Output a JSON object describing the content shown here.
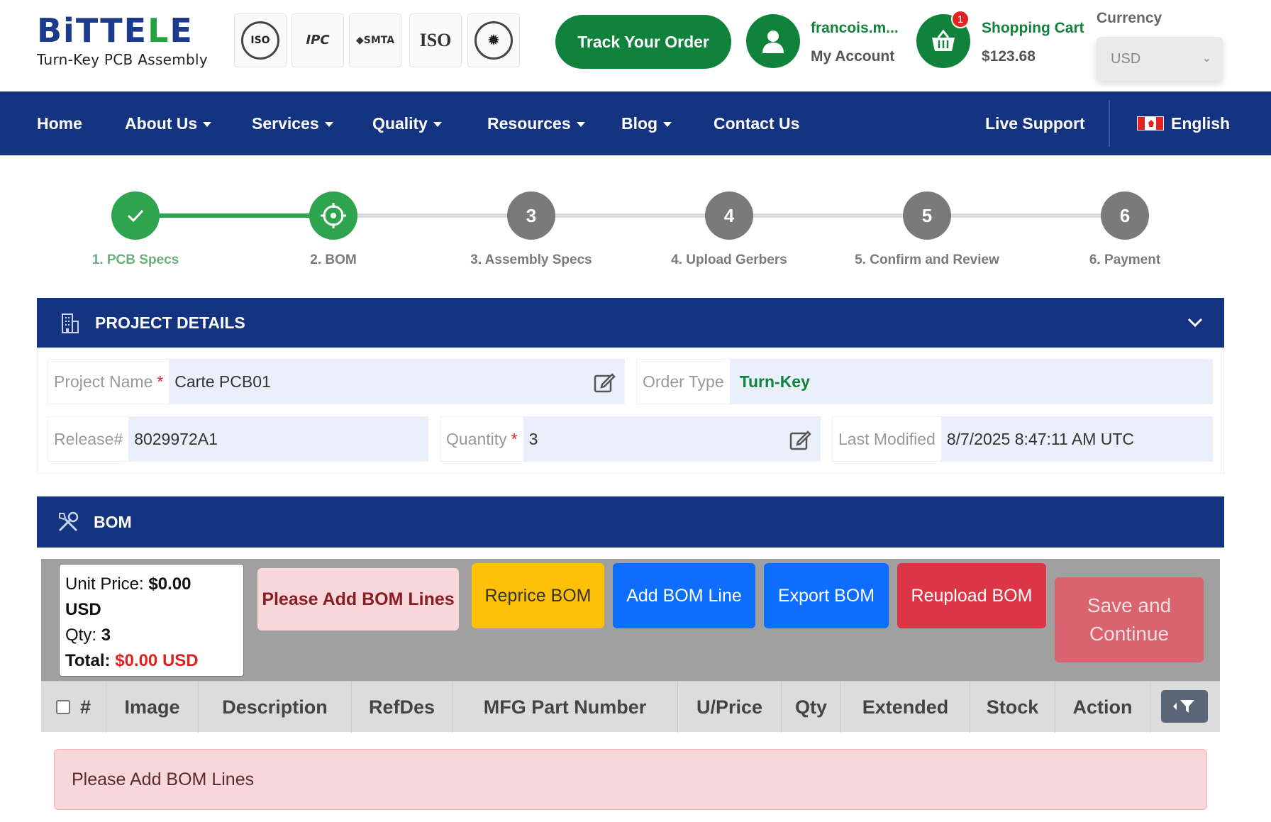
{
  "header": {
    "logo": {
      "word_part1": "BiTTE",
      "word_part2": "L",
      "word_part3": "E",
      "tagline": "Turn-Key PCB Assembly"
    },
    "certifications": [
      {
        "name": "iso-9001-badge",
        "text": "ISO"
      },
      {
        "name": "ipc-badge",
        "text": "IPC"
      },
      {
        "name": "smta-badge",
        "text": "SMTA"
      },
      {
        "name": "iso-13485-badge",
        "text": "ISO"
      },
      {
        "name": "ontario-made-badge",
        "text": "✹"
      }
    ],
    "track_order_label": "Track Your Order",
    "account": {
      "username": "francois.m...",
      "label": "My Account"
    },
    "cart": {
      "label": "Shopping Cart",
      "amount": "$123.68",
      "badge": "1"
    },
    "currency": {
      "label": "Currency",
      "selected": "USD"
    }
  },
  "nav": {
    "items": [
      {
        "label": "Home",
        "dropdown": false
      },
      {
        "label": "About Us",
        "dropdown": true
      },
      {
        "label": "Services",
        "dropdown": true
      },
      {
        "label": "Quality",
        "dropdown": true
      },
      {
        "label": "Resources",
        "dropdown": true
      },
      {
        "label": "Blog",
        "dropdown": true
      },
      {
        "label": "Contact Us",
        "dropdown": false
      }
    ],
    "live_support": "Live Support",
    "language": "English"
  },
  "stepper": {
    "steps": [
      {
        "number": "",
        "label": "1. PCB Specs",
        "state": "complete"
      },
      {
        "number": "",
        "label": "2. BOM",
        "state": "active"
      },
      {
        "number": "3",
        "label": "3. Assembly Specs",
        "state": "pending"
      },
      {
        "number": "4",
        "label": "4. Upload Gerbers",
        "state": "pending"
      },
      {
        "number": "5",
        "label": "5. Confirm and Review",
        "state": "pending"
      },
      {
        "number": "6",
        "label": "6. Payment",
        "state": "pending"
      }
    ]
  },
  "project": {
    "title": "PROJECT DETAILS",
    "project_name_label": "Project Name",
    "project_name": "Carte PCB01",
    "order_type_label": "Order Type",
    "order_type": "Turn-Key",
    "release_label": "Release#",
    "release": "8029972A1",
    "quantity_label": "Quantity",
    "quantity": "3",
    "last_modified_label": "Last Modified",
    "last_modified": "8/7/2025 8:47:11 AM UTC"
  },
  "bom": {
    "title": "BOM",
    "summary": {
      "unit_price_label": "Unit Price:",
      "unit_price": "$0.00",
      "unit_price_currency": "USD",
      "qty_label": "Qty:",
      "qty": "3",
      "total_label": "Total:",
      "total": "$0.00 USD"
    },
    "buttons": {
      "please_add": "Please Add BOM Lines",
      "reprice": "Reprice BOM",
      "add_line": "Add BOM Line",
      "export": "Export BOM",
      "reupload": "Reupload BOM",
      "save_continue": "Save and Continue"
    },
    "columns": [
      "#",
      "Image",
      "Description",
      "RefDes",
      "MFG Part Number",
      "U/Price",
      "Qty",
      "Extended",
      "Stock",
      "Action"
    ],
    "empty_message": "Please Add BOM Lines"
  },
  "colors": {
    "brand_green": "#11823b",
    "brand_blue": "#143381",
    "warning": "#ffc107",
    "primary": "#0d6efd",
    "danger": "#dc3545"
  }
}
